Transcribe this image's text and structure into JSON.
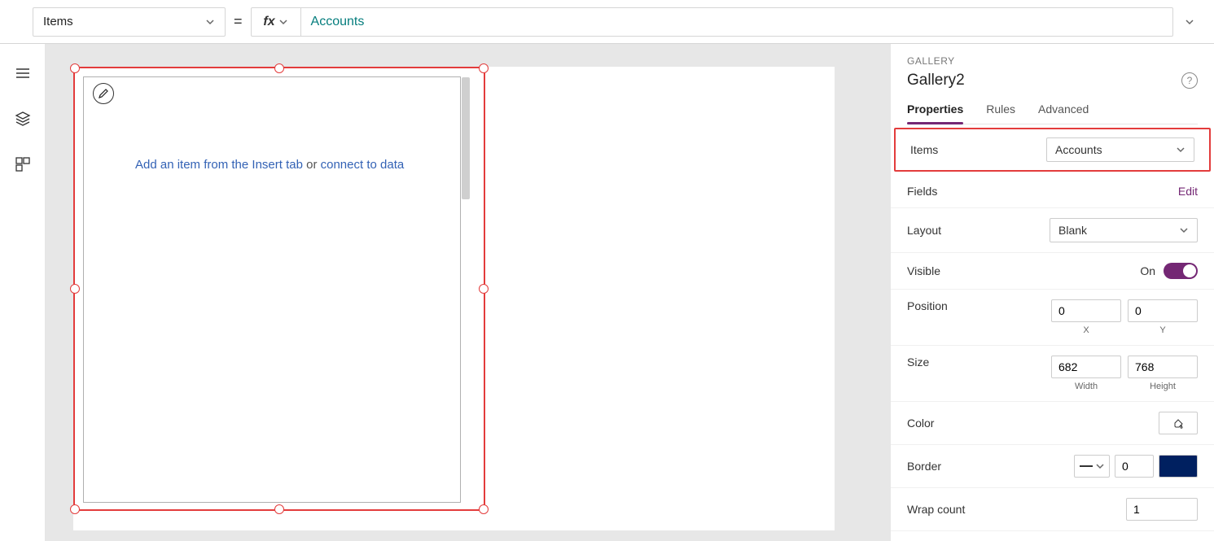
{
  "formula_bar": {
    "property_name": "Items",
    "equals": "=",
    "fx_label": "fx",
    "expression": "Accounts"
  },
  "canvas": {
    "hint_prefix": "Add an item from the Insert tab",
    "hint_or": " or ",
    "hint_link": "connect to data"
  },
  "panel": {
    "kind": "GALLERY",
    "name": "Gallery2",
    "help": "?",
    "tabs": {
      "properties": "Properties",
      "rules": "Rules",
      "advanced": "Advanced"
    },
    "items": {
      "label": "Items",
      "value": "Accounts"
    },
    "fields": {
      "label": "Fields",
      "edit": "Edit"
    },
    "layout": {
      "label": "Layout",
      "value": "Blank"
    },
    "visible": {
      "label": "Visible",
      "state": "On"
    },
    "position": {
      "label": "Position",
      "x": "0",
      "y": "0",
      "xlabel": "X",
      "ylabel": "Y"
    },
    "size": {
      "label": "Size",
      "w": "682",
      "h": "768",
      "wlabel": "Width",
      "hlabel": "Height"
    },
    "color": {
      "label": "Color"
    },
    "border": {
      "label": "Border",
      "width": "0"
    },
    "wrap": {
      "label": "Wrap count",
      "value": "1"
    }
  }
}
